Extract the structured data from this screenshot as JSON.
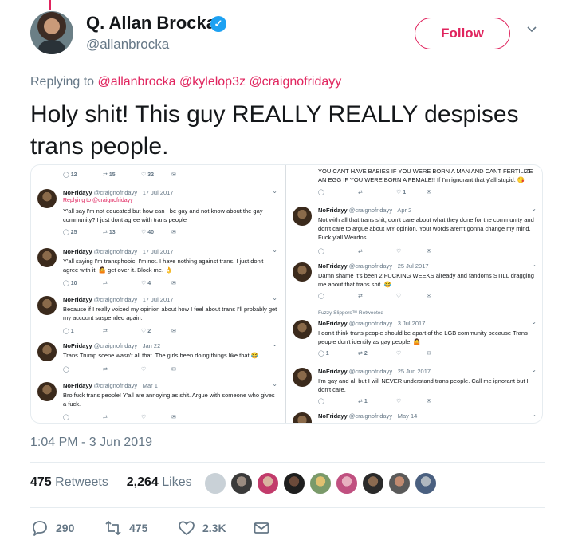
{
  "author": {
    "name": "Q. Allan Brocka",
    "handle": "@allanbrocka",
    "verified_icon": "verified-badge-icon",
    "follow_label": "Follow"
  },
  "replying": {
    "prefix": "Replying to",
    "mentions": [
      "@allanbrocka",
      "@kylelop3z",
      "@craignofridayy"
    ]
  },
  "tweet": {
    "text": "Holy shit! This guy REALLY REALLY despises trans people.",
    "timestamp": "1:04 PM - 3 Jun 2019"
  },
  "stats": {
    "retweets_count": "475",
    "retweets_label": "Retweets",
    "likes_count": "2,264",
    "likes_label": "Likes"
  },
  "actions": {
    "replies": "290",
    "retweets": "475",
    "likes": "2.3K"
  },
  "screenshot": {
    "left": {
      "top_actions": [
        "12",
        "15",
        "32"
      ],
      "tweets": [
        {
          "name": "NoFridayy",
          "meta": "@craignofridayy · 17 Jul 2017",
          "reply": "Replying to @craignofridayy",
          "text": "Y'all say I'm not educated but how can I be gay and not know about the gay community? I just dont agree with trans people",
          "counts": [
            "25",
            "13",
            "40"
          ]
        },
        {
          "name": "NoFridayy",
          "meta": "@craignofridayy · 17 Jul 2017",
          "text": "Y'all saying I'm transphobic. I'm not. I have nothing against trans. I just don't agree with it. 🤷 get over it. Block me. 👌",
          "counts": [
            "10",
            "",
            "4"
          ]
        },
        {
          "name": "NoFridayy",
          "meta": "@craignofridayy · 17 Jul 2017",
          "text": "Because if I really voiced my opinion about how I feel about trans I'll probably get my account suspended again.",
          "counts": [
            "1",
            "",
            "2"
          ]
        },
        {
          "name": "NoFridayy",
          "meta": "@craignofridayy · Jan 22",
          "text": "Trans Trump scene wasn't all that. The girls been doing things like that 😂",
          "counts": [
            "",
            "",
            ""
          ]
        },
        {
          "name": "NoFridayy",
          "meta": "@craignofridayy · Mar 1",
          "text": "Bro fuck trans people! Y'all are annoying as shit. Argue with someone who gives a fuck.",
          "counts": [
            "",
            "",
            ""
          ]
        }
      ]
    },
    "right": {
      "top_text": "YOU CANT HAVE BABIES IF YOU WERE BORN A MAN AND CANT FERTILIZE AN EGG IF YOU WERE BORN A FEMALE!! If I'm ignorant that y'all stupid. 😘",
      "top_counts": [
        "",
        "",
        "1"
      ],
      "tweets": [
        {
          "name": "NoFridayy",
          "meta": "@craignofridayy · Apr 2",
          "text": "Not with all that trans shit, don't care about what they done for the community and don't care to argue about MY opinion. Your words aren't gonna change my mind. Fuck y'all Weirdos",
          "counts": [
            "",
            "",
            ""
          ]
        },
        {
          "name": "NoFridayy",
          "meta": "@craignofridayy · 25 Jul 2017",
          "text": "Damn shame it's been 2 FUCKING WEEKS already and fandoms STILL dragging me about that trans shit. 😂",
          "counts": [
            "",
            "",
            ""
          ]
        },
        {
          "retweeted": "Fuzzy Slippers™ Retweeted",
          "name": "NoFridayy",
          "meta": "@craignofridayy · 3 Jul 2017",
          "text": "I don't think trans people should be apart of the LGB community because Trans people don't identify as gay people. 🤷",
          "counts": [
            "1",
            "2",
            ""
          ]
        },
        {
          "name": "NoFridayy",
          "meta": "@craignofridayy · 25 Jun 2017",
          "text": "I'm gay and all but I will NEVER understand trans people. Call me ignorant but I don't care.",
          "counts": [
            "",
            "1",
            ""
          ]
        },
        {
          "name": "NoFridayy",
          "meta": "@craignofridayy · May 14",
          "text": "",
          "counts": []
        }
      ]
    }
  },
  "colors": {
    "accent": "#e0245e",
    "link": "#e0245e",
    "muted": "#657786",
    "verified": "#1da1f2"
  }
}
